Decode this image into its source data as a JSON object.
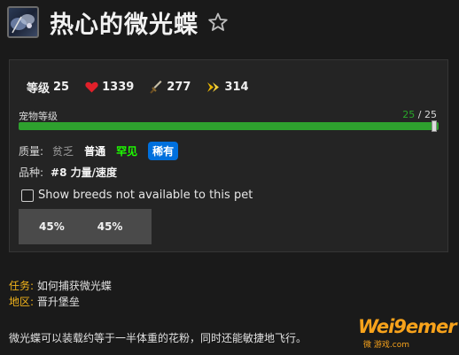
{
  "pet": {
    "name": "热心的微光蝶",
    "icon": "moth-portrait-icon",
    "favorite_icon": "star-outline-icon"
  },
  "stats": {
    "level_label": "等级",
    "level": "25",
    "health": "1339",
    "power": "277",
    "speed": "314"
  },
  "pet_level": {
    "label": "宠物等级",
    "current": "25",
    "separator": " / ",
    "max": "25",
    "progress": 1.0
  },
  "quality": {
    "label": "质量:",
    "options": [
      "贫乏",
      "普通",
      "罕见",
      "稀有"
    ],
    "selected": "稀有"
  },
  "breed": {
    "label": "品种:",
    "value": "#8 力量/速度"
  },
  "show_breeds": {
    "label": "Show breeds not available to this pet",
    "checked": false
  },
  "breed_stats": [
    "45%",
    "45%"
  ],
  "info": {
    "task_label": "任务:",
    "task_value": "如何捕获微光蝶",
    "zone_label": "地区:",
    "zone_value": "晋升堡垒"
  },
  "description": "微光蝶可以装载约等于一半体重的花粉，同时还能敏捷地飞行。",
  "watermark": {
    "text": "Wei9emer",
    "sub": "游戏.com",
    "prefix": "微"
  },
  "colors": {
    "accent_green": "#2ea12e",
    "rare_blue": "#0070dd",
    "uncommon_green": "#1eff00",
    "label_gold": "#f0b21a",
    "heart_red": "#e0202a",
    "speed_gold": "#e8b400"
  }
}
